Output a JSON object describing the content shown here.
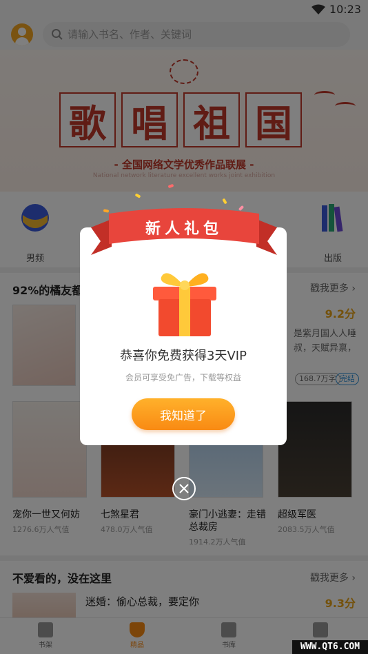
{
  "status_bar": {
    "time": "10:23"
  },
  "search": {
    "placeholder": "请输入书名、作者、关键词"
  },
  "banner": {
    "characters": [
      "歌",
      "唱",
      "祖",
      "国"
    ],
    "subtitle": "- 全国网络文学优秀作品联展 -",
    "subtitle_en": "National network literature excellent works joint exhibition"
  },
  "categories": [
    "男频",
    "出版"
  ],
  "section1": {
    "title": "92%的橘友都",
    "more": "戳我更多 ›",
    "featured": {
      "score": "9.2分",
      "desc_line1": "是紫月国人人唾",
      "desc_line2": "叔，天赋异禀，",
      "tags": [
        "168.7万字",
        "完结"
      ]
    },
    "books": [
      {
        "title": "宠你一世又何妨",
        "pop": "1276.6万人气值"
      },
      {
        "title": "七煞星君",
        "pop": "478.0万人气值"
      },
      {
        "title": "豪门小逃妻：走错总裁房",
        "pop": "1914.2万人气值"
      },
      {
        "title": "超级军医",
        "pop": "2083.5万人气值"
      }
    ]
  },
  "section2": {
    "title": "不爱看的，没在这里",
    "more": "戳我更多 ›",
    "book": {
      "title": "迷婚：偷心总裁，要定你",
      "score": "9.3分"
    }
  },
  "tabbar": [
    "书架",
    "精品",
    "书库",
    ""
  ],
  "dialog": {
    "ribbon": "新人礼包",
    "title": "恭喜你免费获得3天VIP",
    "subtitle": "会员可享受免广告，下载等权益",
    "button": "我知道了"
  },
  "watermark": "WWW.QT6.COM",
  "colors": {
    "accent": "#f98a13",
    "ribbon": "#e8453c",
    "score": "#e8a317",
    "banner_red": "#c0392b"
  }
}
